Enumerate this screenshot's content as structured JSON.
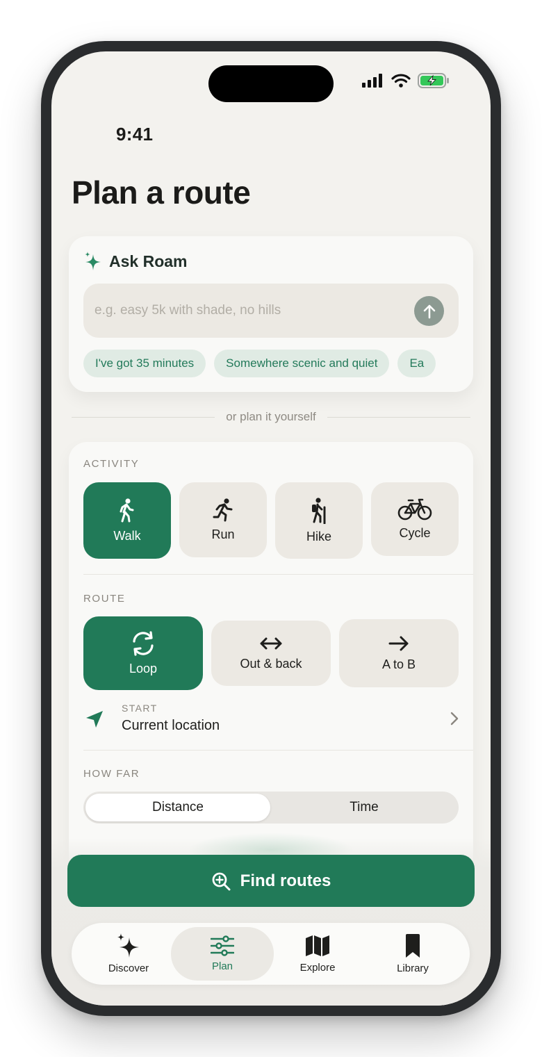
{
  "status_bar": {
    "time": "9:41",
    "icons": [
      "signal-icon",
      "wifi-icon",
      "battery-charging-icon"
    ]
  },
  "page": {
    "title": "Plan a route"
  },
  "ask": {
    "title": "Ask Roam",
    "placeholder": "e.g. easy 5k with shade, no hills",
    "value": "",
    "suggestions": [
      "I've got 35 minutes",
      "Somewhere scenic and quiet",
      "Ea"
    ]
  },
  "divider_text": "or plan it yourself",
  "activity": {
    "label": "ACTIVITY",
    "options": [
      {
        "label": "Walk",
        "icon": "walk-icon",
        "selected": true
      },
      {
        "label": "Run",
        "icon": "run-icon",
        "selected": false
      },
      {
        "label": "Hike",
        "icon": "hike-icon",
        "selected": false
      },
      {
        "label": "Cycle",
        "icon": "bicycle-icon",
        "selected": false
      }
    ]
  },
  "route": {
    "label": "ROUTE",
    "options": [
      {
        "label": "Loop",
        "icon": "loop-icon",
        "selected": true
      },
      {
        "label": "Out & back",
        "icon": "arrows-left-right-icon",
        "selected": false
      },
      {
        "label": "A to B",
        "icon": "arrow-right-icon",
        "selected": false
      }
    ],
    "start": {
      "label": "START",
      "value": "Current location"
    }
  },
  "how_far": {
    "label": "HOW FAR",
    "options": [
      "Distance",
      "Time"
    ],
    "selected": "Distance"
  },
  "cta": {
    "label": "Find routes"
  },
  "tabs": [
    {
      "label": "Discover",
      "icon": "sparkles-icon",
      "active": false
    },
    {
      "label": "Plan",
      "icon": "sliders-icon",
      "active": true
    },
    {
      "label": "Explore",
      "icon": "map-icon",
      "active": false
    },
    {
      "label": "Library",
      "icon": "bookmark-icon",
      "active": false
    }
  ],
  "colors": {
    "accent": "#217a58",
    "background": "#f3f2ee",
    "tile": "#ece9e3",
    "chip_bg": "#e0ebe4"
  }
}
